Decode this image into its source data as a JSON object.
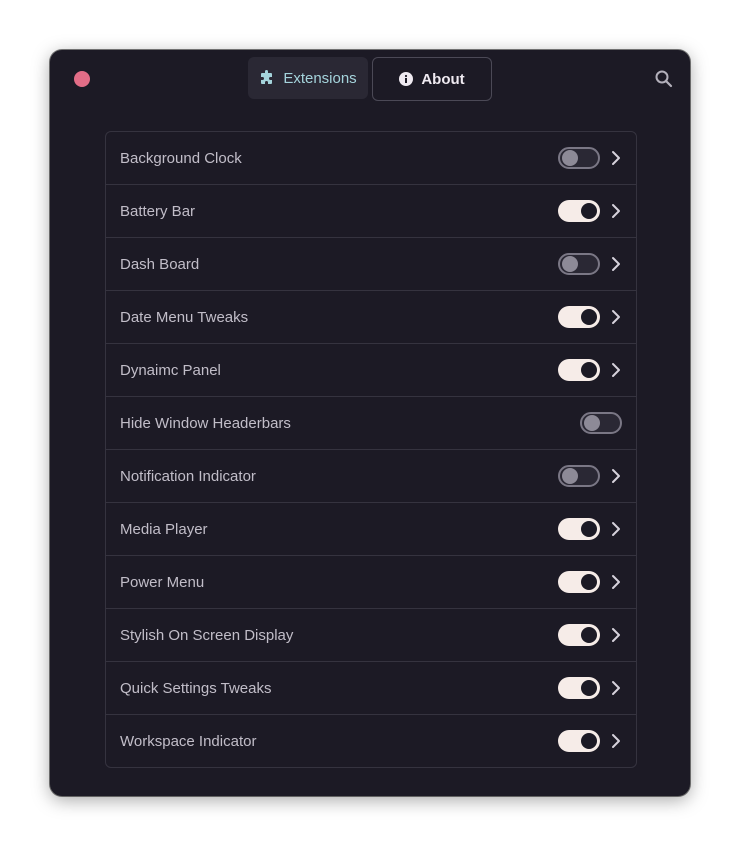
{
  "window": {
    "tabs": [
      {
        "label": "Extensions",
        "icon": "puzzle-icon",
        "active": true
      },
      {
        "label": "About",
        "icon": "info-icon",
        "active": false
      }
    ]
  },
  "colors": {
    "accent": "#a4d3db",
    "close": "#e26d87",
    "switch_on": "#f6ece8"
  },
  "extensions": [
    {
      "label": "Background Clock",
      "enabled": false,
      "has_settings": true
    },
    {
      "label": "Battery Bar",
      "enabled": true,
      "has_settings": true
    },
    {
      "label": "Dash Board",
      "enabled": false,
      "has_settings": true
    },
    {
      "label": "Date Menu Tweaks",
      "enabled": true,
      "has_settings": true
    },
    {
      "label": "Dynaimc Panel",
      "enabled": true,
      "has_settings": true
    },
    {
      "label": "Hide Window Headerbars",
      "enabled": false,
      "has_settings": false
    },
    {
      "label": "Notification Indicator",
      "enabled": false,
      "has_settings": true
    },
    {
      "label": "Media Player",
      "enabled": true,
      "has_settings": true
    },
    {
      "label": "Power Menu",
      "enabled": true,
      "has_settings": true
    },
    {
      "label": "Stylish On Screen Display",
      "enabled": true,
      "has_settings": true
    },
    {
      "label": "Quick Settings Tweaks",
      "enabled": true,
      "has_settings": true
    },
    {
      "label": "Workspace Indicator",
      "enabled": true,
      "has_settings": true
    }
  ]
}
